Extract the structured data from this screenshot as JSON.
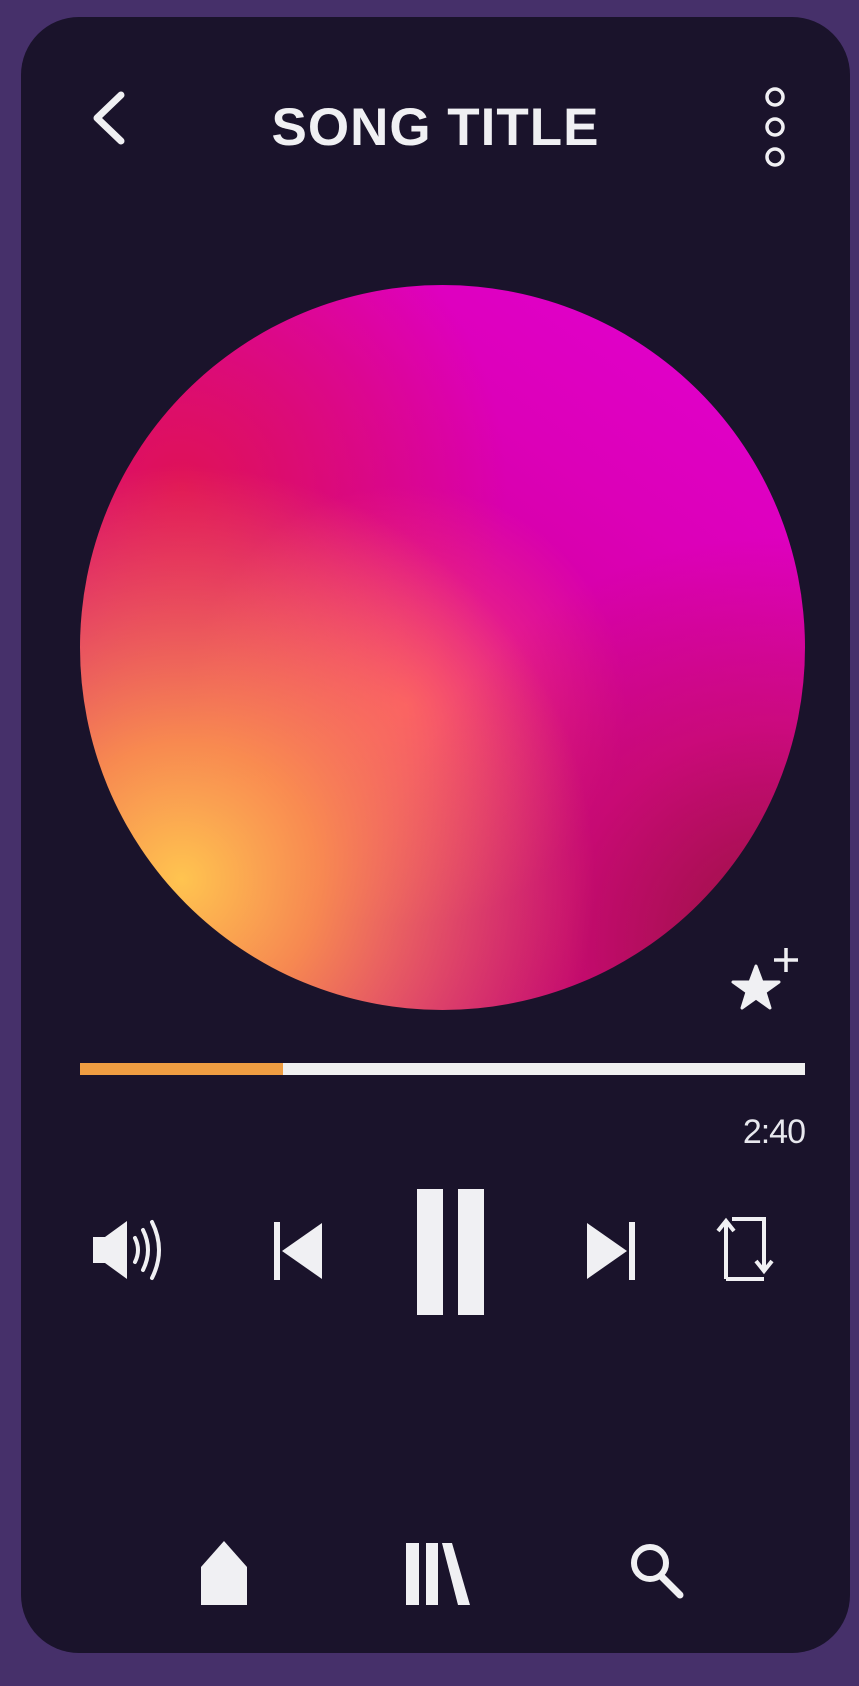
{
  "header": {
    "title": "SONG TITLE",
    "back_icon": "chevron-left-icon",
    "more_icon": "vertical-dots-icon"
  },
  "artwork": {
    "description_icon": "album-art-gradient"
  },
  "favorite": {
    "icon": "star-plus-icon"
  },
  "playback": {
    "progress_fraction": 0.28,
    "time_remaining": "2:40"
  },
  "controls": {
    "volume_icon": "speaker-volume-icon",
    "previous_icon": "skip-previous-icon",
    "pause_icon": "pause-icon",
    "next_icon": "skip-next-icon",
    "repeat_icon": "repeat-icon"
  },
  "nav": {
    "home_icon": "home-icon",
    "library_icon": "library-icon",
    "search_icon": "search-icon"
  },
  "colors": {
    "background": "#1a132b",
    "frame": "#46306a",
    "accent": "#ef9d42",
    "foreground": "#f0f0f3"
  }
}
